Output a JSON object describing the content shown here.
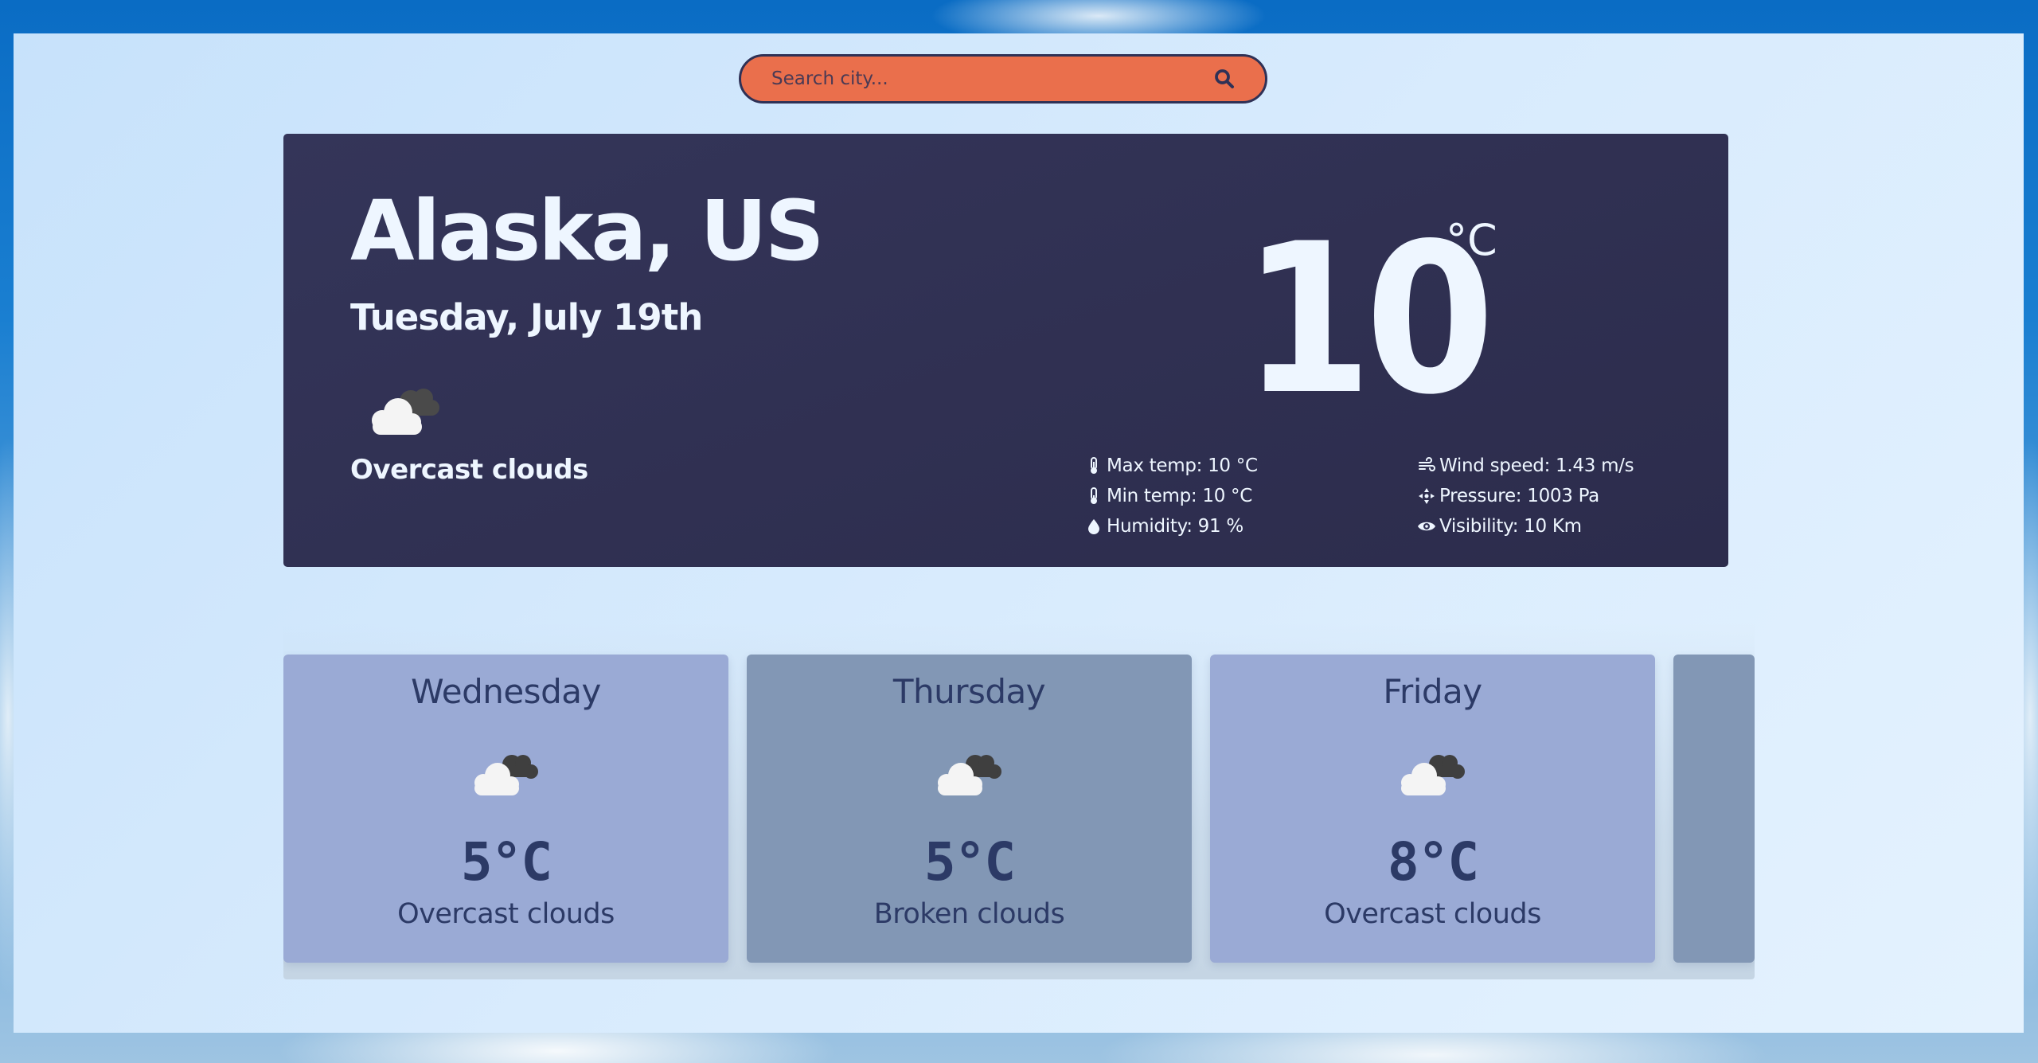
{
  "search": {
    "placeholder": "Search city...",
    "value": ""
  },
  "current": {
    "city": "Alaska, US",
    "date": "Tuesday, July 19th",
    "icon": "overcast-clouds-icon",
    "description": "Overcast clouds",
    "temperature": "10",
    "unit": "°C",
    "stats_left": [
      {
        "icon": "thermometer-icon",
        "label": "Max temp: 10 °C"
      },
      {
        "icon": "thermometer-icon",
        "label": "Min temp: 10 °C"
      },
      {
        "icon": "droplet-icon",
        "label": "Humidity: 91 %"
      }
    ],
    "stats_right": [
      {
        "icon": "wind-icon",
        "label": "Wind speed: 1.43 m/s"
      },
      {
        "icon": "pressure-icon",
        "label": "Pressure: 1003 Pa"
      },
      {
        "icon": "eye-icon",
        "label": "Visibility: 10 Km"
      }
    ]
  },
  "forecast": [
    {
      "day": "Wednesday",
      "temp": "5°C",
      "description": "Overcast clouds",
      "icon": "overcast-clouds-icon"
    },
    {
      "day": "Thursday",
      "temp": "5°C",
      "description": "Broken clouds",
      "icon": "broken-clouds-icon"
    },
    {
      "day": "Friday",
      "temp": "8°C",
      "description": "Overcast clouds",
      "icon": "overcast-clouds-icon"
    }
  ],
  "colors": {
    "search_bg": "#ea6f4c",
    "main_card_bg": "#343559",
    "forecast_card_light": "#9aaad5",
    "forecast_card_dark": "#8297b5",
    "forecast_text": "#2c3a66"
  }
}
